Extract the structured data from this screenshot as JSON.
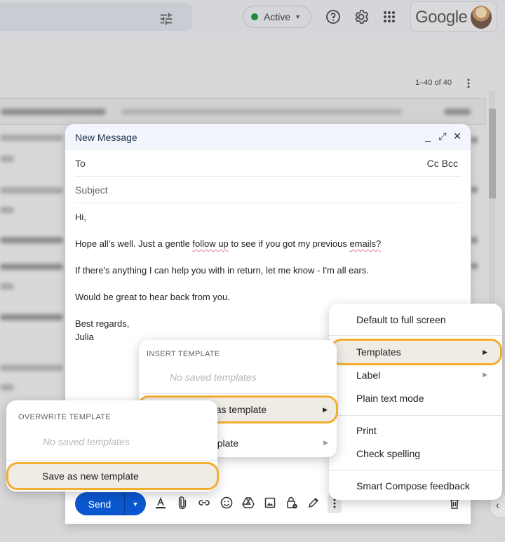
{
  "topbar": {
    "status": {
      "label": "Active",
      "dot_color": "#1e8e3e",
      "icon": "caret-down-icon"
    },
    "icons": [
      "tune-icon",
      "help-icon",
      "settings-gear-icon",
      "apps-grid-icon"
    ],
    "brand": "Google",
    "account_avatar": "user-avatar"
  },
  "mail_list": {
    "pagination": "1–40 of 40",
    "more_icon": "more-vert-icon"
  },
  "compose": {
    "title": "New Message",
    "header_icons": [
      "minimize-icon",
      "expand-icon",
      "close-icon"
    ],
    "to_label": "To",
    "cc_bcc_label": "Cc Bcc",
    "subject_placeholder": "Subject",
    "body": {
      "greeting": "Hi,",
      "line1_a": "Hope all’s well. Just a gentle ",
      "line1_sp1": "follow up",
      "line1_b": " to see if you got my previous ",
      "line1_sp2": "emails?",
      "line2": "If there's anything I can help you with in return, let me know - I'm all ears.",
      "line3": "Would be great to hear back from you.",
      "signoff": "Best regards,",
      "name": "Julia"
    },
    "send_label": "Send",
    "send_options_icon": "caret-down-icon",
    "toolbar_icons": [
      "text-format-icon",
      "attach-icon",
      "link-icon",
      "emoji-icon",
      "drive-icon",
      "photo-icon",
      "confidential-lock-icon",
      "signature-pen-icon",
      "more-options-icon",
      "discard-trash-icon"
    ]
  },
  "more_options_menu": {
    "items": [
      {
        "label": "Default to full screen"
      },
      {
        "label": "Templates",
        "submenu": true,
        "highlighted": true
      },
      {
        "label": "Label",
        "submenu": true
      },
      {
        "label": "Plain text mode"
      },
      {
        "label": "Print"
      },
      {
        "label": "Check spelling"
      },
      {
        "label": "Smart Compose feedback"
      }
    ]
  },
  "templates_menu": {
    "section_title": "INSERT TEMPLATE",
    "empty_text": "No saved templates",
    "items": [
      {
        "label": "Save draft as template",
        "icon": "save-template-icon",
        "submenu": true,
        "highlighted": true
      },
      {
        "label": "Delete template",
        "icon": "trash-icon",
        "submenu": true
      }
    ]
  },
  "save_draft_menu": {
    "section_title": "OVERWRITE TEMPLATE",
    "empty_text": "No saved templates",
    "items": [
      {
        "label": "Save as new template",
        "highlighted": true
      }
    ]
  },
  "colors": {
    "highlight_border": "#f2ae2f",
    "send_button": "#0b57d0",
    "spellcheck_underline": "#e07a9a"
  }
}
